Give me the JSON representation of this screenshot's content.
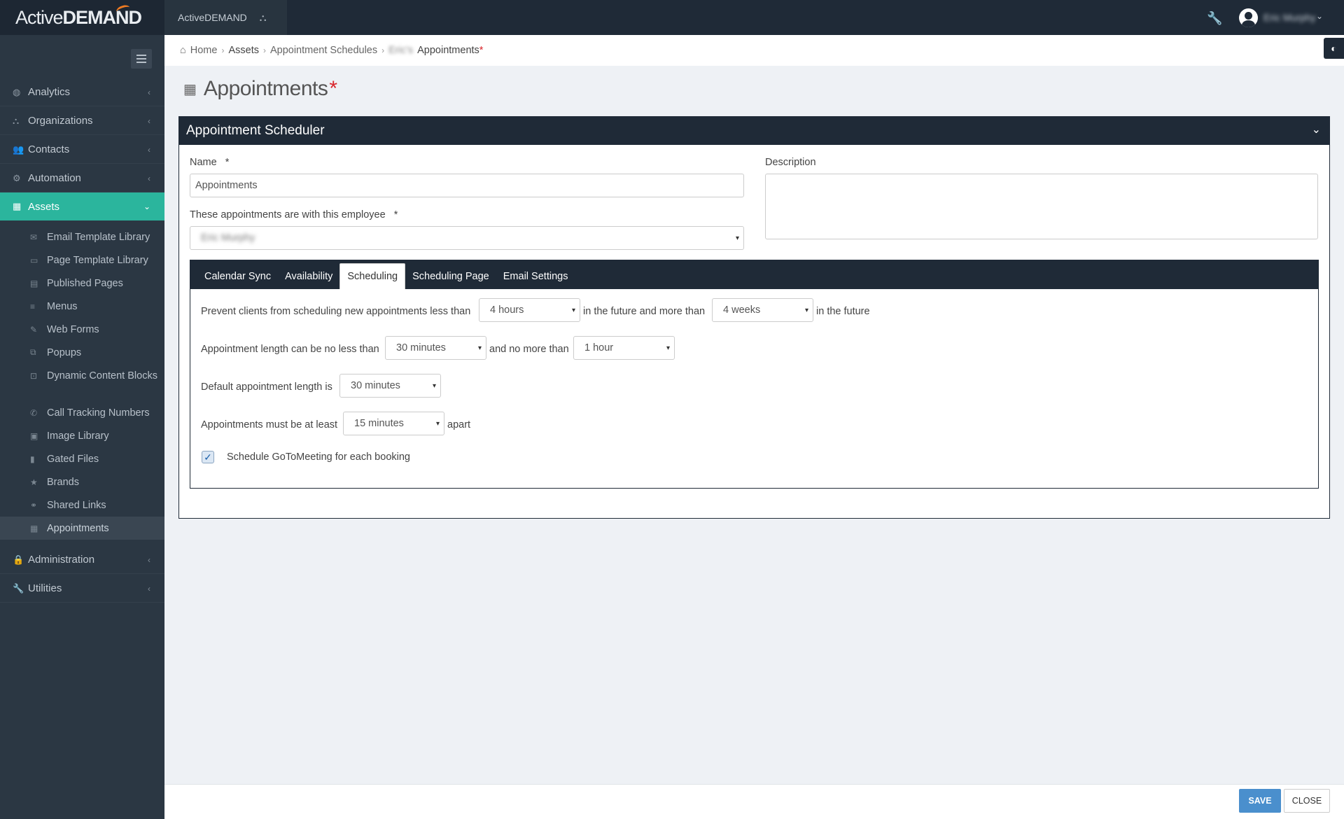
{
  "logo": {
    "part1": "Active",
    "part2": "DEMAND"
  },
  "topbar": {
    "app_name": "ActiveDEMAND",
    "app_icon": "sitemap-icon",
    "tools_icon": "wrench-icon",
    "user_name": "Eric Murphy",
    "user_caret": "⌄"
  },
  "sidebar": {
    "nav": [
      {
        "label": "Analytics",
        "icon": "◍",
        "chev": "‹"
      },
      {
        "label": "Organizations",
        "icon": "⛬",
        "chev": "‹"
      },
      {
        "label": "Contacts",
        "icon": "👥",
        "chev": "‹"
      },
      {
        "label": "Automation",
        "icon": "⚙",
        "chev": "‹"
      },
      {
        "label": "Assets",
        "icon": "▦",
        "chev": "⌄"
      }
    ],
    "sub_items": [
      {
        "label": "Email Template Library",
        "icon": "✉"
      },
      {
        "label": "Page Template Library",
        "icon": "▭"
      },
      {
        "label": "Published Pages",
        "icon": "▤"
      },
      {
        "label": "Menus",
        "icon": "≡"
      },
      {
        "label": "Web Forms",
        "icon": "✎"
      },
      {
        "label": "Popups",
        "icon": "⧉"
      },
      {
        "label": "Dynamic Content Blocks",
        "icon": "⊡"
      },
      {
        "label": "Call Tracking Numbers",
        "icon": "✆"
      },
      {
        "label": "Image Library",
        "icon": "▣"
      },
      {
        "label": "Gated Files",
        "icon": "▮"
      },
      {
        "label": "Brands",
        "icon": "★"
      },
      {
        "label": "Shared Links",
        "icon": "⚭"
      },
      {
        "label": "Appointments",
        "icon": "▦"
      }
    ],
    "bottom_nav": [
      {
        "label": "Administration",
        "icon": "🔒",
        "chev": "‹"
      },
      {
        "label": "Utilities",
        "icon": "🔧",
        "chev": "‹"
      }
    ]
  },
  "breadcrumb": {
    "home_icon": "⌂",
    "home": "Home",
    "sep": "›",
    "assets": "Assets",
    "schedules": "Appointment Schedules",
    "owner": "Eric's",
    "current": "Appointments",
    "star": "*"
  },
  "collapse_icon": "◐",
  "page": {
    "title_icon": "▦",
    "title": "Appointments",
    "star": "*"
  },
  "panel": {
    "title": "Appointment Scheduler",
    "chev": "⌄",
    "name_label": "Name",
    "name_req": "*",
    "name_value": "Appointments",
    "employee_label": "These appointments are with this employee",
    "employee_req": "*",
    "employee_value": "Eric Murphy",
    "description_label": "Description",
    "caret": "▾"
  },
  "tabs": [
    {
      "label": "Calendar Sync"
    },
    {
      "label": "Availability"
    },
    {
      "label": "Scheduling"
    },
    {
      "label": "Scheduling Page"
    },
    {
      "label": "Email Settings"
    }
  ],
  "scheduling": {
    "row1_a": "Prevent clients from scheduling new appointments less than",
    "row1_sel1": "4 hours",
    "row1_b": "in the future and more than",
    "row1_sel2": "4 weeks",
    "row1_c": "in the future",
    "row2_a": "Appointment length can be no less than",
    "row2_sel1": "30 minutes",
    "row2_b": "and no more than",
    "row2_sel2": "1 hour",
    "row3_a": "Default appointment length is",
    "row3_sel": "30 minutes",
    "row4_a": "Appointments must be at least",
    "row4_sel": "15 minutes",
    "row4_b": "apart",
    "gtm_check": "✓",
    "gtm_label": "Schedule GoToMeeting for each booking"
  },
  "footer": {
    "save": "SAVE",
    "close": "CLOSE"
  },
  "colors": {
    "sidebar": "#2b3743",
    "topbar": "#1f2a37",
    "accent": "#2bb59d",
    "primary_button": "#4a8fcd",
    "required": "#d9262c"
  }
}
